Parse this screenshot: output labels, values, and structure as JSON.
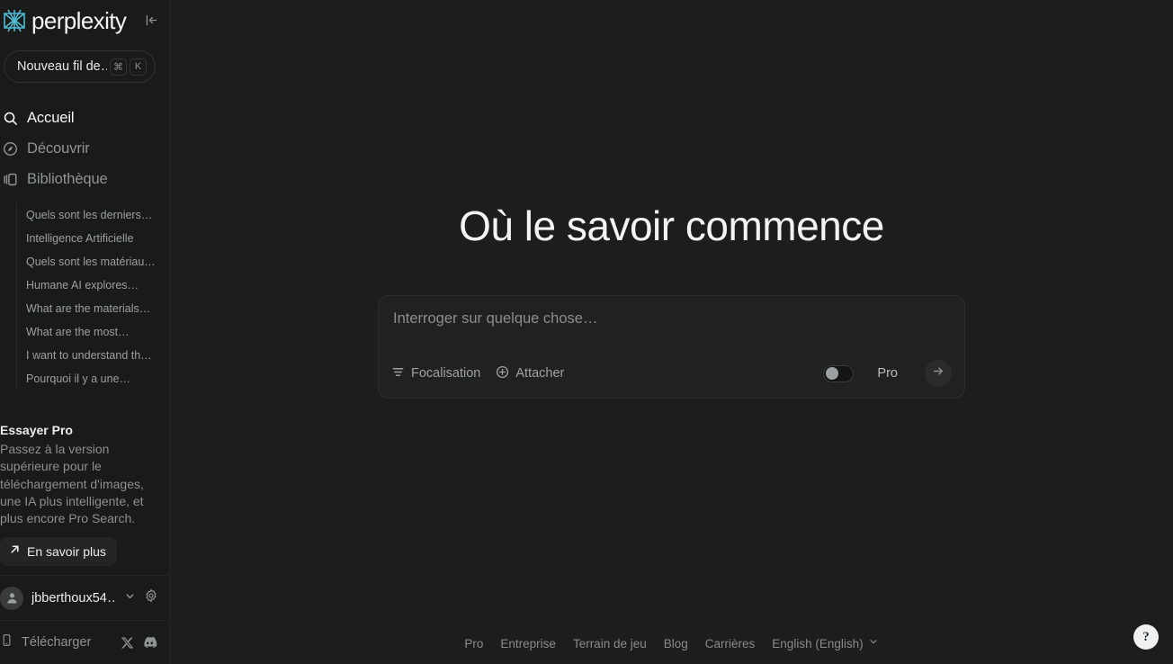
{
  "brand": {
    "name": "perplexity",
    "logo_color": "#4fbcd4",
    "logo_icon": "perplexity-logo-icon"
  },
  "sidebar": {
    "collapse_icon": "collapse-sidebar-icon",
    "new_thread": {
      "label": "Nouveau fil de…",
      "key_modifier": "⌘",
      "key_letter": "K"
    },
    "nav": [
      {
        "label": "Accueil",
        "icon": "search-icon",
        "active": true
      },
      {
        "label": "Découvrir",
        "icon": "compass-icon",
        "active": false
      },
      {
        "label": "Bibliothèque",
        "icon": "library-icon",
        "active": false
      }
    ],
    "threads": [
      "Quels sont les derniers…",
      "Intelligence Artificielle",
      "Quels sont les matériau…",
      "Humane AI explores…",
      "What are the materials…",
      "What are the most…",
      "I want to understand th…",
      "Pourquoi il y a une…"
    ],
    "promo": {
      "title": "Essayer Pro",
      "text": "Passez à la version supérieure pour le téléchargement d'images, une IA plus intelligente, et plus encore Pro Search.",
      "button_label": "En savoir plus",
      "button_icon": "arrow-up-right-icon"
    },
    "account": {
      "name": "jbberthoux54…",
      "avatar_icon": "user-avatar-icon",
      "chevron_icon": "chevron-down-icon",
      "settings_icon": "gear-icon"
    },
    "bottom": {
      "download_label": "Télécharger",
      "download_icon": "mobile-download-icon",
      "twitter_icon": "x-twitter-icon",
      "discord_icon": "discord-icon"
    }
  },
  "main": {
    "hero_title": "Où le savoir commence",
    "ask": {
      "placeholder": "Interroger sur quelque chose…",
      "value": "",
      "focus_label": "Focalisation",
      "focus_icon": "focus-filter-icon",
      "attach_label": "Attacher",
      "attach_icon": "plus-circle-icon",
      "pro_label": "Pro",
      "pro_enabled": false,
      "submit_icon": "arrow-right-icon"
    },
    "footer": {
      "links": [
        "Pro",
        "Entreprise",
        "Terrain de jeu",
        "Blog",
        "Carrières"
      ],
      "language": "English (English)",
      "language_chevron": "chevron-down-icon"
    },
    "help_label": "?"
  }
}
